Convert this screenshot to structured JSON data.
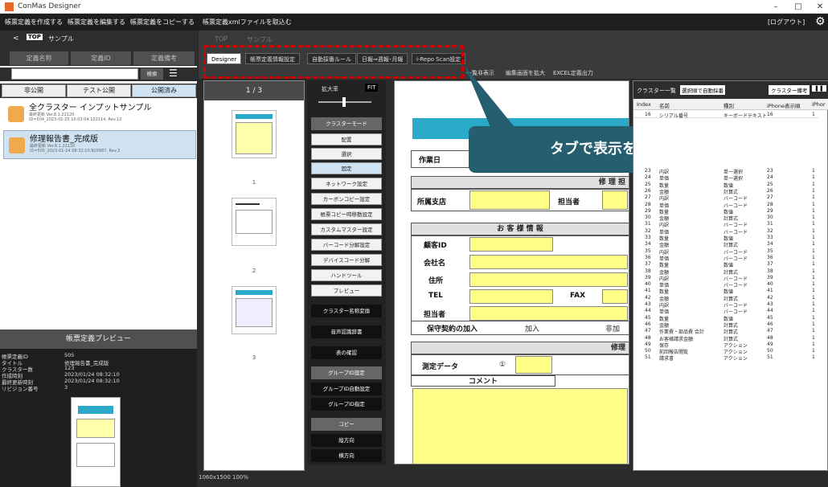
{
  "app": {
    "title": "ConMas Designer",
    "minimize": "–",
    "maximize": "□",
    "close": "✕"
  },
  "menubar": {
    "items": [
      "帳票定義を作成する",
      "帳票定義を編集する",
      "帳票定義をコピーする",
      "帳票定義xmlファイルを取込む"
    ],
    "logout": "[ログアウト]",
    "settings_icon": "gear-icon"
  },
  "leftnav": {
    "back": "<",
    "top": "TOP",
    "label": "サンプル"
  },
  "columns": [
    "定義名称",
    "定義ID",
    "定義備考"
  ],
  "search": {
    "button": "検索"
  },
  "tabs3": [
    "非公開",
    "テスト公開",
    "公開済み"
  ],
  "items": [
    {
      "name": "全クラスター インプットサンプル",
      "ver": "最終更新 Ver.8.1.22120",
      "meta": "ID=504_2023-01-25 10:03:04.102114, Rev.12"
    },
    {
      "name": "修理報告書_完成版",
      "ver": "最終更新 Ver.8.1.22120",
      "meta": "ID=505_2023-01-24 08:32:10.920987, Rev.3"
    }
  ],
  "preview": {
    "header": "帳票定義プレビュー",
    "rows": [
      [
        "帳票定義ID",
        "505"
      ],
      [
        "タイトル",
        "修理報告書_完成版"
      ],
      [
        "クラスター数",
        "123"
      ],
      [
        "作成時刻",
        "2023/01/24 08:32:10"
      ],
      [
        "最終更新時刻",
        "2023/01/24 08:32:10"
      ],
      [
        "リビジョン番号",
        "3"
      ]
    ]
  },
  "toptabs": {
    "crumbs": [
      "TOP",
      "サンプル"
    ],
    "tabs": [
      "Designer",
      "帳票定義情報設定",
      "自動採番ルール",
      "日報⇒週報･月報",
      "i-Repo Scan設定"
    ],
    "actions": [
      "一覧非表示",
      "編集画面を拡大",
      "EXCEL定義出力"
    ]
  },
  "thumbs": {
    "page": "1 / 3",
    "numbers": [
      "1",
      "2",
      "3"
    ]
  },
  "tools": {
    "zoom": "拡大率",
    "fit": "FIT",
    "mode": "クラスターモード",
    "buttons": [
      "配置",
      "選択",
      "固定",
      "ネットワーク設定",
      "カーボンコピー設定",
      "帳票コピー時移動設定",
      "カスタムマスター設定",
      "バーコード分解設定",
      "デバイスコード分解",
      "ハンドツール",
      "プレビュー"
    ],
    "dark": [
      "クラスター名称変換",
      "音声認識辞書",
      "表の確認"
    ],
    "group": "グループID設定",
    "groupbtns": [
      "グループID自動設定",
      "グループID指定"
    ],
    "copy": "コピー",
    "copybtns": [
      "縦方向",
      "横方向"
    ]
  },
  "canvas": {
    "date": "作業日",
    "branch": "所属支店",
    "staff": "担当者",
    "customer": "お 客 様 情 報",
    "custid": "顧客ID",
    "company": "会社名",
    "address": "住所",
    "tel": "TEL",
    "fax": "FAX",
    "person": "担当者",
    "maint": "保守契約の加入",
    "join": "加入",
    "nojoin": "非加",
    "measure": "測定データ",
    "circle1": "①",
    "comment": "コメント",
    "repair": "修 理 担",
    "repair2": "修理"
  },
  "callout": "タブで表示を切り替えます",
  "cluster": {
    "title": "クラスター一覧",
    "sort": "選択順で自動採番",
    "note": "クラスター備考",
    "pause": "❚❚",
    "cols": [
      "Index",
      "名前",
      "種別",
      "iPhone表示順",
      "iPhor"
    ],
    "rows": [
      [
        "16",
        "シリアル番号",
        "キーボードテキスト",
        "16",
        "1"
      ],
      [
        "23",
        "内訳",
        "単一選択",
        "23",
        "1"
      ],
      [
        "24",
        "単価",
        "単一選択",
        "24",
        "1"
      ],
      [
        "25",
        "数量",
        "数値",
        "25",
        "1"
      ],
      [
        "26",
        "金額",
        "計算式",
        "26",
        "1"
      ],
      [
        "27",
        "内訳",
        "バーコード",
        "27",
        "1"
      ],
      [
        "28",
        "単価",
        "バーコード",
        "28",
        "1"
      ],
      [
        "29",
        "数量",
        "数値",
        "29",
        "1"
      ],
      [
        "30",
        "金額",
        "計算式",
        "30",
        "1"
      ],
      [
        "31",
        "内訳",
        "バーコード",
        "31",
        "1"
      ],
      [
        "32",
        "単価",
        "バーコード",
        "32",
        "1"
      ],
      [
        "33",
        "数量",
        "数値",
        "33",
        "1"
      ],
      [
        "34",
        "金額",
        "計算式",
        "34",
        "1"
      ],
      [
        "35",
        "内訳",
        "バーコード",
        "35",
        "1"
      ],
      [
        "36",
        "単価",
        "バーコード",
        "36",
        "1"
      ],
      [
        "37",
        "数量",
        "数値",
        "37",
        "1"
      ],
      [
        "38",
        "金額",
        "計算式",
        "38",
        "1"
      ],
      [
        "39",
        "内訳",
        "バーコード",
        "39",
        "1"
      ],
      [
        "40",
        "単価",
        "バーコード",
        "40",
        "1"
      ],
      [
        "41",
        "数量",
        "数値",
        "41",
        "1"
      ],
      [
        "42",
        "金額",
        "計算式",
        "42",
        "1"
      ],
      [
        "43",
        "内訳",
        "バーコード",
        "43",
        "1"
      ],
      [
        "44",
        "単価",
        "バーコード",
        "44",
        "1"
      ],
      [
        "45",
        "数量",
        "数値",
        "45",
        "1"
      ],
      [
        "46",
        "金額",
        "計算式",
        "46",
        "1"
      ],
      [
        "47",
        "作業費・部品費 合計",
        "計算式",
        "47",
        "1"
      ],
      [
        "48",
        "お客様請求金額",
        "計算式",
        "48",
        "1"
      ],
      [
        "49",
        "保存",
        "アクション",
        "49",
        "1"
      ],
      [
        "50",
        "前回報告閲覧",
        "アクション",
        "50",
        "1"
      ],
      [
        "51",
        "請求書",
        "アクション",
        "51",
        "1"
      ]
    ]
  },
  "status": "1060x1500 100%",
  "colors": {
    "accent": "#255e6f",
    "selected": "#cfe3f2",
    "yellow": "#ffff88",
    "teal": "#2aa9c9",
    "red": "#d50000"
  }
}
